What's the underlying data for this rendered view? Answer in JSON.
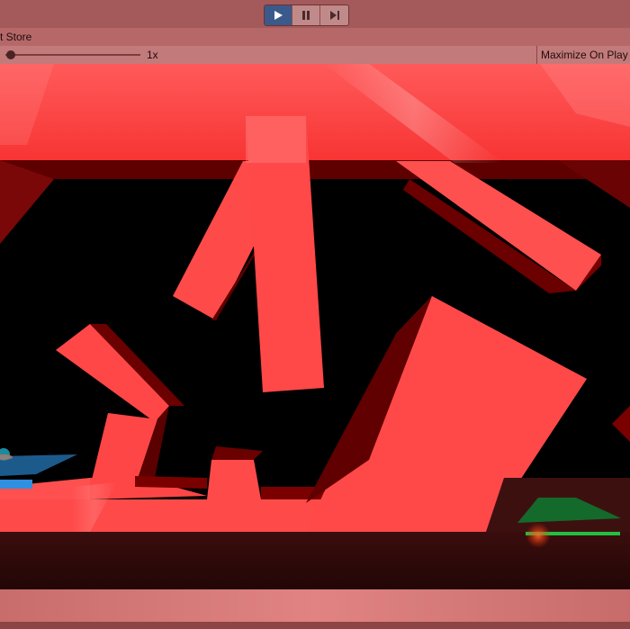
{
  "toolbar": {
    "buttons": [
      {
        "name": "play-button",
        "icon": "play-icon",
        "active": true
      },
      {
        "name": "pause-button",
        "icon": "pause-icon",
        "active": false
      },
      {
        "name": "step-button",
        "icon": "step-icon",
        "active": false
      }
    ]
  },
  "tab": {
    "label": "t Store"
  },
  "controls": {
    "scale_label": "1x",
    "maximize_label": "Maximize On Play"
  },
  "colors": {
    "accent_active": "#3a5a8c",
    "block_red": "#ff4a4a",
    "block_dark": "#5e0000",
    "start_pad_blue": "#2f8fe0",
    "goal_pad_green": "#20c040"
  }
}
